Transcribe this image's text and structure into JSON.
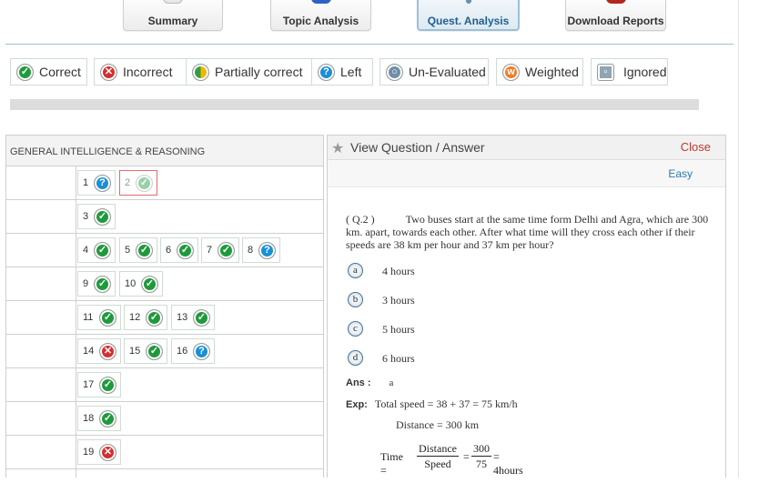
{
  "tabs": [
    {
      "label": "Summary"
    },
    {
      "label": "Topic Analysis"
    },
    {
      "label": "Quest. Analysis"
    },
    {
      "label": "Download Reports"
    }
  ],
  "legend": [
    {
      "label": "Correct"
    },
    {
      "label": "Incorrect"
    },
    {
      "label": "Partially correct"
    },
    {
      "label": "Left"
    },
    {
      "label": "Un-Evaluated"
    },
    {
      "label": "Weighted"
    },
    {
      "label": "Ignored"
    }
  ],
  "section": {
    "title": "GENERAL INTELLIGENCE & REASONING"
  },
  "questions": [
    {
      "no": "1",
      "status": "left"
    },
    {
      "no": "2",
      "status": "correct"
    },
    {
      "no": "3",
      "status": "correct"
    },
    {
      "no": "4",
      "status": "correct"
    },
    {
      "no": "5",
      "status": "correct"
    },
    {
      "no": "6",
      "status": "correct"
    },
    {
      "no": "7",
      "status": "correct"
    },
    {
      "no": "8",
      "status": "left"
    },
    {
      "no": "9",
      "status": "correct"
    },
    {
      "no": "10",
      "status": "correct"
    },
    {
      "no": "11",
      "status": "correct"
    },
    {
      "no": "12",
      "status": "correct"
    },
    {
      "no": "13",
      "status": "correct"
    },
    {
      "no": "14",
      "status": "incorrect"
    },
    {
      "no": "15",
      "status": "correct"
    },
    {
      "no": "16",
      "status": "left"
    },
    {
      "no": "17",
      "status": "correct"
    },
    {
      "no": "18",
      "status": "correct"
    },
    {
      "no": "19",
      "status": "incorrect"
    }
  ],
  "panel": {
    "title": "View Question / Answer",
    "close_label": "Close",
    "difficulty": "Easy",
    "question_no": "( Q.2 )",
    "question_text": "Two buses start at the same time form Delhi and Agra, which are 300 km. apart, towards each other. After what time will they cross each other if their speeds are 38 km per hour and 37 km per hour?",
    "options": [
      {
        "key": "a",
        "text": "4 hours"
      },
      {
        "key": "b",
        "text": "3 hours"
      },
      {
        "key": "c",
        "text": "5 hours"
      },
      {
        "key": "d",
        "text": "6 hours"
      }
    ],
    "answer_label": "Ans :",
    "answer_value": "a",
    "exp_label": "Exp:",
    "exp_line1": "Total speed = 38 + 37 = 75 km/h",
    "exp_line2": "Distance = 300 km",
    "formula": {
      "lhs": "Time =",
      "frac1_num": "Distance",
      "frac1_den": "Speed",
      "eq": "=",
      "frac2_num": "300",
      "frac2_den": "75",
      "result": "= 4hours"
    }
  },
  "colors": {
    "correct": "#1e9a3c",
    "incorrect": "#d32f2f",
    "left": "#1a8fd6",
    "close": "#c0392b",
    "difficulty": "#2a7ab8"
  }
}
